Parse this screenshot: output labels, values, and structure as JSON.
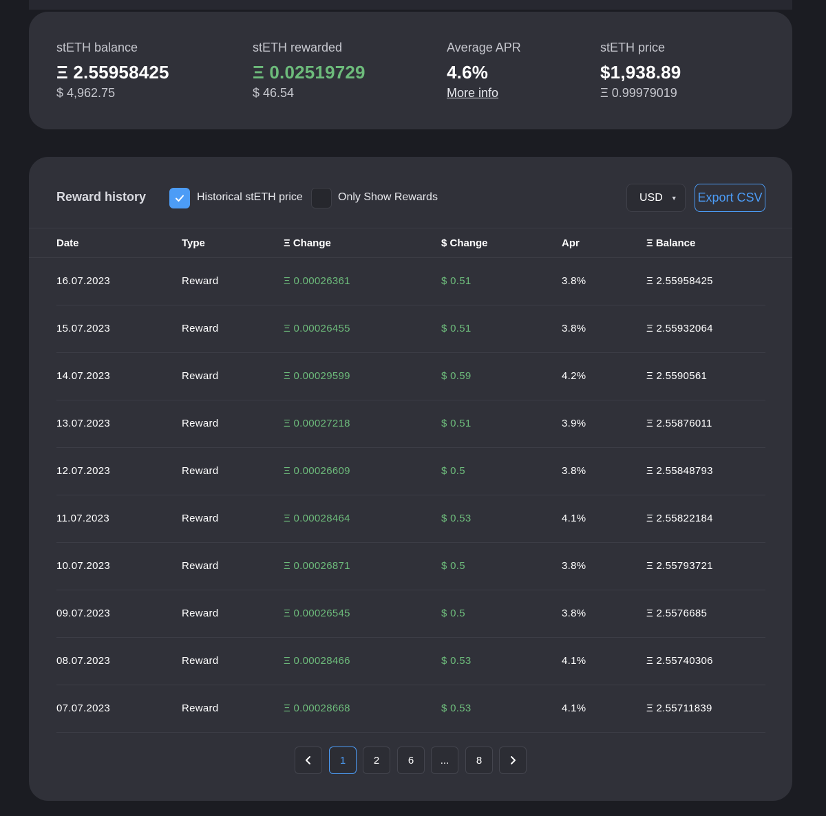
{
  "summary": {
    "balance": {
      "label": "stETH balance",
      "value": "Ξ 2.55958425",
      "sub": "$ 4,962.75"
    },
    "rewarded": {
      "label": "stETH rewarded",
      "value": "Ξ 0.02519729",
      "sub": "$ 46.54"
    },
    "apr": {
      "label": "Average APR",
      "value": "4.6%",
      "sub": "More info"
    },
    "price": {
      "label": "stETH price",
      "value": "$1,938.89",
      "sub": "Ξ 0.99979019"
    }
  },
  "history": {
    "title": "Reward history",
    "historical_price": {
      "label": "Historical stETH price",
      "checked": true
    },
    "only_rewards": {
      "label": "Only Show Rewards",
      "checked": false
    },
    "currency": "USD",
    "export_label": "Export CSV",
    "columns": [
      "Date",
      "Type",
      "Ξ Change",
      "$ Change",
      "Apr",
      "Ξ Balance"
    ],
    "rows": [
      {
        "date": "16.07.2023",
        "type": "Reward",
        "change": "Ξ 0.00026361",
        "usd": "$ 0.51",
        "apr": "3.8%",
        "balance": "Ξ 2.55958425"
      },
      {
        "date": "15.07.2023",
        "type": "Reward",
        "change": "Ξ 0.00026455",
        "usd": "$ 0.51",
        "apr": "3.8%",
        "balance": "Ξ 2.55932064"
      },
      {
        "date": "14.07.2023",
        "type": "Reward",
        "change": "Ξ 0.00029599",
        "usd": "$ 0.59",
        "apr": "4.2%",
        "balance": "Ξ 2.5590561"
      },
      {
        "date": "13.07.2023",
        "type": "Reward",
        "change": "Ξ 0.00027218",
        "usd": "$ 0.51",
        "apr": "3.9%",
        "balance": "Ξ 2.55876011"
      },
      {
        "date": "12.07.2023",
        "type": "Reward",
        "change": "Ξ 0.00026609",
        "usd": "$ 0.5",
        "apr": "3.8%",
        "balance": "Ξ 2.55848793"
      },
      {
        "date": "11.07.2023",
        "type": "Reward",
        "change": "Ξ 0.00028464",
        "usd": "$ 0.53",
        "apr": "4.1%",
        "balance": "Ξ 2.55822184"
      },
      {
        "date": "10.07.2023",
        "type": "Reward",
        "change": "Ξ 0.00026871",
        "usd": "$ 0.5",
        "apr": "3.8%",
        "balance": "Ξ 2.55793721"
      },
      {
        "date": "09.07.2023",
        "type": "Reward",
        "change": "Ξ 0.00026545",
        "usd": "$ 0.5",
        "apr": "3.8%",
        "balance": "Ξ 2.5576685"
      },
      {
        "date": "08.07.2023",
        "type": "Reward",
        "change": "Ξ 0.00028466",
        "usd": "$ 0.53",
        "apr": "4.1%",
        "balance": "Ξ 2.55740306"
      },
      {
        "date": "07.07.2023",
        "type": "Reward",
        "change": "Ξ 0.00028668",
        "usd": "$ 0.53",
        "apr": "4.1%",
        "balance": "Ξ 2.55711839"
      }
    ],
    "pagination": {
      "pages": [
        "1",
        "2",
        "6",
        "...",
        "8"
      ],
      "current": "1"
    }
  },
  "colors": {
    "accent": "#4c9cf6",
    "positive": "#6dbb7b",
    "card": "#303139",
    "background": "#1b1c22"
  },
  "icons": {
    "checkbox_checked": "check-icon",
    "prev": "chevron-left-icon",
    "next": "chevron-right-icon",
    "select": "caret-down-icon"
  }
}
